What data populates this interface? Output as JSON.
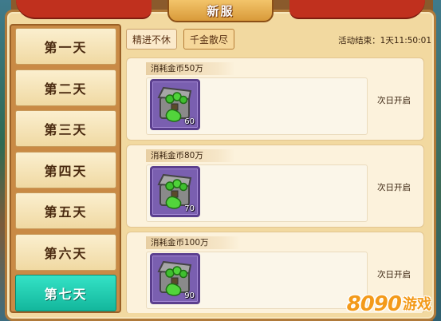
{
  "window": {
    "title": "新服"
  },
  "sidebar": {
    "items": [
      {
        "label": "第一天"
      },
      {
        "label": "第二天"
      },
      {
        "label": "第三天"
      },
      {
        "label": "第四天"
      },
      {
        "label": "第五天"
      },
      {
        "label": "第六天"
      },
      {
        "label": "第七天",
        "selected": true
      }
    ]
  },
  "tabs": [
    {
      "label": "精进不休"
    },
    {
      "label": "千金散尽",
      "selected": true
    }
  ],
  "event": {
    "countdown_text": "活动结束：1天11:50:01"
  },
  "tasks": [
    {
      "label": "消耗金币50万",
      "reward": {
        "icon": "treasure-chest-icon",
        "count": "60"
      },
      "status": "次日开启"
    },
    {
      "label": "消耗金币80万",
      "reward": {
        "icon": "treasure-chest-icon",
        "count": "70"
      },
      "status": "次日开启"
    },
    {
      "label": "消耗金币100万",
      "reward": {
        "icon": "treasure-chest-icon",
        "count": "90"
      },
      "status": "次日开启"
    }
  ],
  "watermark": {
    "number": "8090",
    "text": "游戏"
  },
  "colors": {
    "active_day": "#1fc8ad",
    "panel": "#f2d9a0",
    "accent_text": "#4a2a10"
  }
}
